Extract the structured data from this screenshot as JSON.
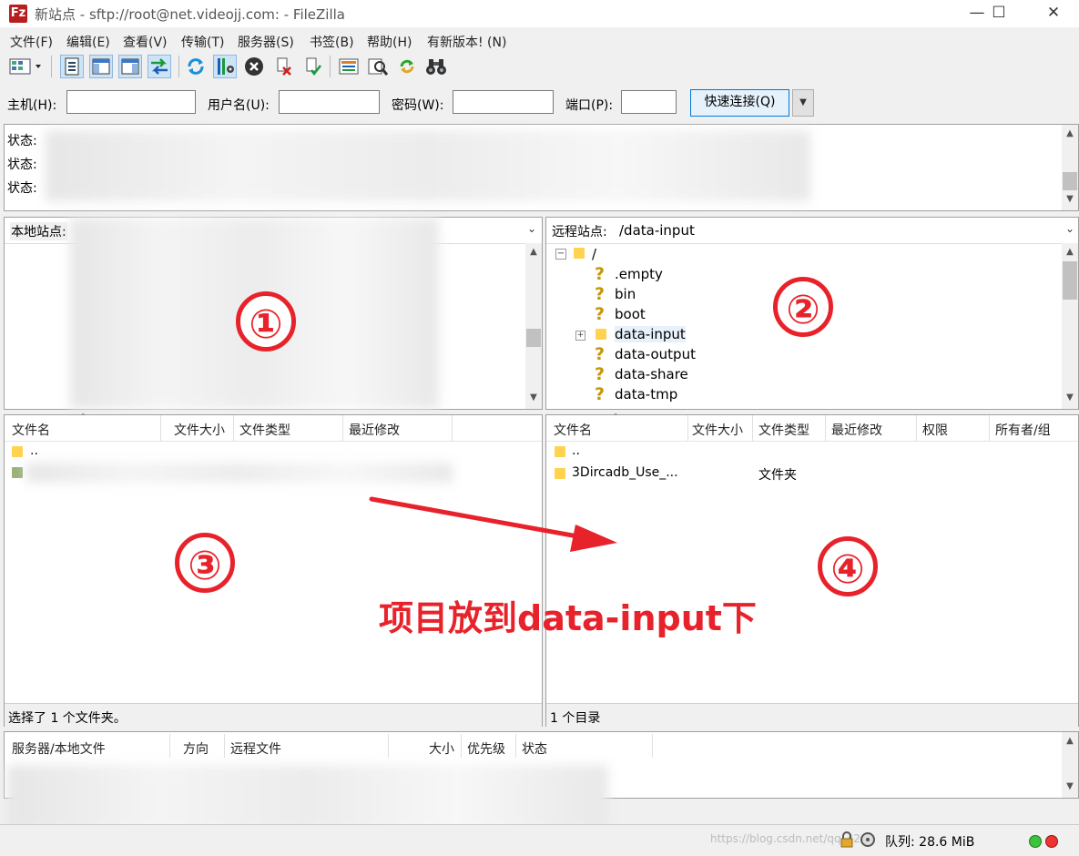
{
  "titlebar": {
    "title": "新站点 - sftp://root@net.videojj.com: - FileZilla",
    "icon": "filezilla-logo-icon",
    "min": "—",
    "max": "☐",
    "close": "✕"
  },
  "menu": [
    "文件(F)",
    "编辑(E)",
    "查看(V)",
    "传输(T)",
    "服务器(S)",
    "书签(B)",
    "帮助(H)",
    "有新版本! (N)"
  ],
  "quickconnect": {
    "host_label": "主机(H):",
    "user_label": "用户名(U):",
    "pass_label": "密码(W):",
    "port_label": "端口(P):",
    "button": "快速连接(Q)",
    "dropdown": "▼"
  },
  "log": [
    "状态:",
    "状态:",
    "状态:"
  ],
  "local": {
    "site_label": "本地站点:",
    "columns": [
      "文件名",
      "文件大小",
      "文件类型",
      "最近修改"
    ],
    "files": [
      ".."
    ],
    "status": "选择了 1 个文件夹。"
  },
  "remote": {
    "site_label": "远程站点:",
    "path": "/data-input",
    "tree_root": "/",
    "tree": [
      ".empty",
      "bin",
      "boot",
      "data-input",
      "data-output",
      "data-share",
      "data-tmp"
    ],
    "columns": [
      "文件名",
      "文件大小",
      "文件类型",
      "最近修改",
      "权限",
      "所有者/组"
    ],
    "files": [
      {
        "name": ".."
      },
      {
        "name": "3Dircadb_Use_...",
        "type": "文件夹"
      }
    ],
    "status": "1 个目录"
  },
  "queue": {
    "columns": [
      "服务器/本地文件",
      "方向",
      "远程文件",
      "大小",
      "优先级",
      "状态"
    ]
  },
  "statusbar": {
    "queue": "队列: 28.6 MiB",
    "watermark": "https://blog.csdn.net/qq_42"
  },
  "annotations": {
    "c1": "①",
    "c2": "②",
    "c3": "③",
    "c4": "④",
    "caption": "项目放到data-input下"
  },
  "colors": {
    "accent": "#e8222a",
    "folder": "#ffd34f",
    "selection": "#cce4f7"
  }
}
